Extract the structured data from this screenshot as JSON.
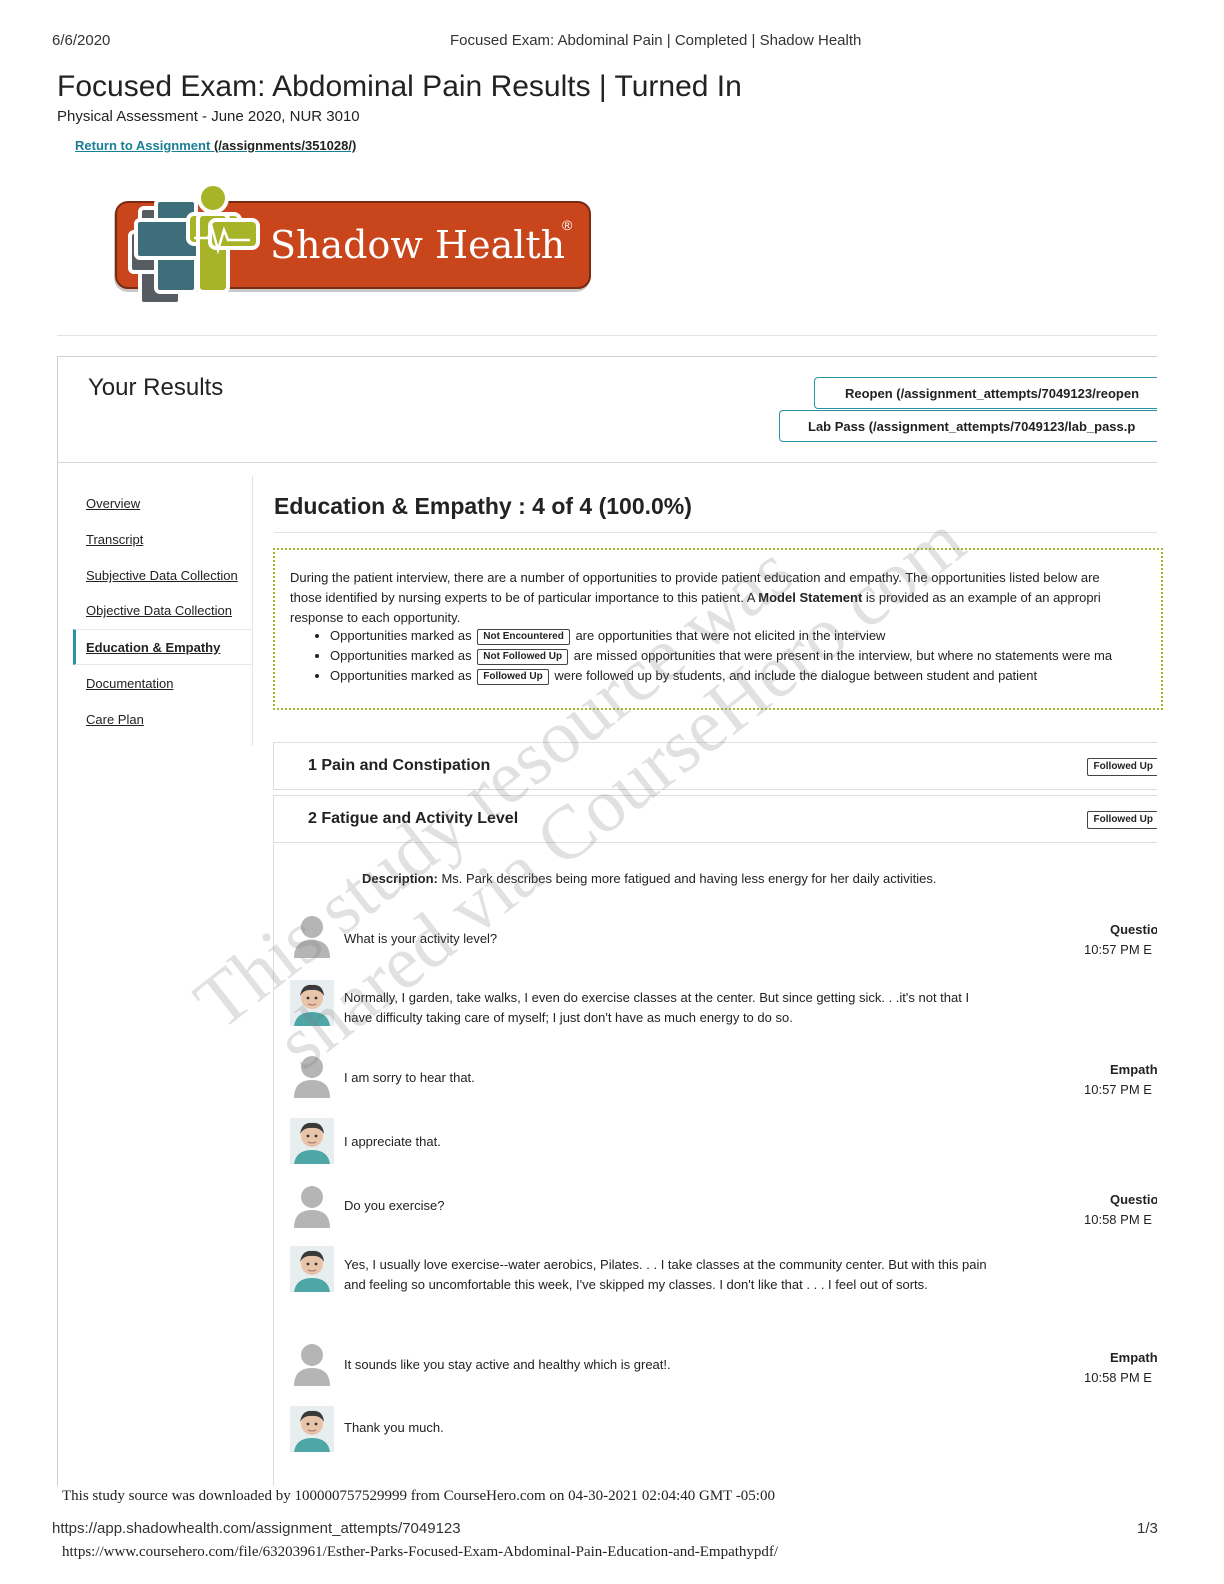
{
  "browser_header": {
    "date": "6/6/2020",
    "title": "Focused Exam: Abdominal Pain | Completed | Shadow Health"
  },
  "page": {
    "title": "Focused Exam: Abdominal Pain Results | Turned In",
    "subtitle": "Physical Assessment - June 2020, NUR 3010",
    "return_link": "Return to Assignment",
    "return_path": "(/assignments/351028/)"
  },
  "logo": {
    "text": "Shadow Health",
    "brand_color": "#c9461c",
    "icon_color": "#a8b428"
  },
  "results": {
    "heading": "Your Results",
    "reopen_button": "Reopen (/assignment_attempts/7049123/reopen",
    "lab_pass_button": "Lab Pass (/assignment_attempts/7049123/lab_pass.p"
  },
  "sidebar": {
    "items": [
      "Overview",
      "Transcript",
      "Subjective Data Collection",
      "Objective Data Collection",
      "Education & Empathy",
      "Documentation",
      "Care Plan"
    ],
    "active_index": 4
  },
  "section": {
    "title": "Education & Empathy : 4 of 4 (100.0%)",
    "intro_line1": "During the patient interview, there are a number of opportunities to provide patient education and empathy. The opportunities listed below are",
    "intro_line2a": "those identified by nursing experts to be of particular importance to this patient. A ",
    "intro_bold": "Model Statement",
    "intro_line2b": " is provided as an example of an appropri",
    "intro_line3": "response to each opportunity.",
    "bullets": [
      {
        "pre": "Opportunities marked as",
        "tag": "Not Encountered",
        "post": "are opportunities that were not elicited in the interview"
      },
      {
        "pre": "Opportunities marked as",
        "tag": "Not Followed Up",
        "post": "are missed opportunities that were present in the interview, but where no statements were ma"
      },
      {
        "pre": "Opportunities marked as",
        "tag": "Followed Up",
        "post": "were followed up by students, and include the dialogue between student and patient"
      }
    ]
  },
  "opportunities": [
    {
      "label": "1 Pain and Constipation",
      "status": "Followed Up"
    },
    {
      "label": "2 Fatigue and Activity Level",
      "status": "Followed Up"
    }
  ],
  "detail": {
    "desc_label": "Description:",
    "desc_text": " Ms. Park describes being more fatigued and having less energy for her daily activities.",
    "dialogue": [
      {
        "speaker": "student",
        "text": "What is your activity level?",
        "type": "Questio",
        "time": "10:57 PM E"
      },
      {
        "speaker": "patient",
        "text": "Normally, I garden, take walks, I even do exercise classes at the center. But since getting sick. . .it's not that I have difficulty taking care of myself; I just don't have as much energy to do so."
      },
      {
        "speaker": "student",
        "text": "I am sorry to hear that.",
        "type": "Empathiz",
        "time": "10:57 PM E"
      },
      {
        "speaker": "patient",
        "text": "I appreciate that."
      },
      {
        "speaker": "student",
        "text": "Do you exercise?",
        "type": "Questio",
        "time": "10:58 PM E"
      },
      {
        "speaker": "patient",
        "text": "Yes, I usually love exercise--water aerobics, Pilates. . . I take classes at the community center. But with this pain and feeling so uncomfortable this week, I've skipped my classes. I don't like that . . . I feel out of sorts."
      },
      {
        "speaker": "student",
        "text": "It sounds like you stay active and healthy which is great!.",
        "type": "Empathiz",
        "time": "10:58 PM E"
      },
      {
        "speaker": "patient",
        "text": "Thank you much."
      }
    ]
  },
  "watermark": {
    "line1": "This study resource was",
    "line2": "shared via CourseHero.com"
  },
  "footer": {
    "source_note": "This study source was downloaded by 100000757529999 from CourseHero.com on 04-30-2021 02:04:40 GMT -05:00",
    "url": "https://app.shadowhealth.com/assignment_attempts/7049123",
    "page": "1/3",
    "file_url": "https://www.coursehero.com/file/63203961/Esther-Parks-Focused-Exam-Abdominal-Pain-Education-and-Empathypdf/"
  }
}
